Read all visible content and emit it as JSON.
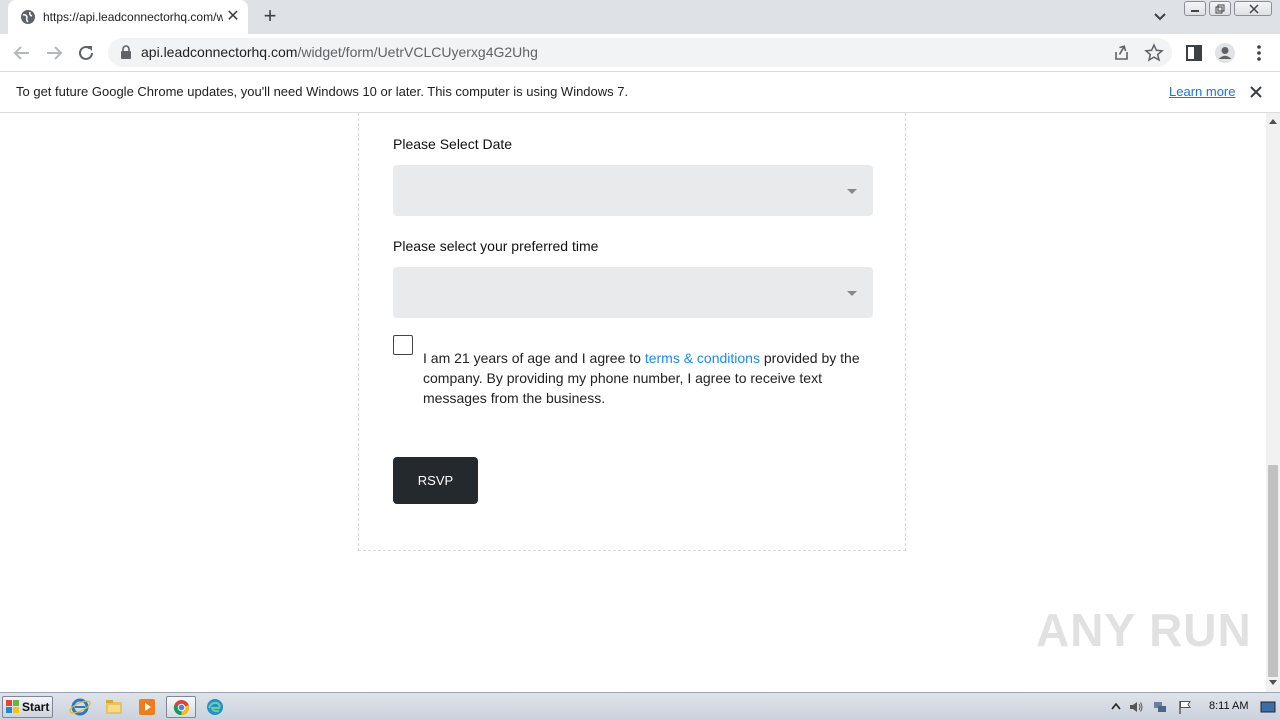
{
  "browser": {
    "tab_title": "https://api.leadconnectorhq.com/wi",
    "address_host": "api.leadconnectorhq.com",
    "address_path": "/widget/form/UetrVCLCUyerxg4G2Uhg"
  },
  "infobar": {
    "message": "To get future Google Chrome updates, you'll need Windows 10 or later. This computer is using Windows 7.",
    "link_label": "Learn more"
  },
  "form": {
    "date_label": "Please Select Date",
    "date_value": "",
    "time_label": "Please select your preferred time",
    "time_value": "",
    "consent_prefix": "I am 21 years of age and I agree to ",
    "consent_link": "terms & conditions",
    "consent_suffix": " provided by the company. By providing my phone number, I agree to receive text messages from the business.",
    "consent_checked": false,
    "submit_label": "RSVP"
  },
  "watermark": "ANY RUN",
  "taskbar": {
    "start_label": "Start",
    "clock": "8:11 AM"
  },
  "colors": {
    "link": "#188bf6",
    "button_bg": "#24292e",
    "select_bg": "#e8eaec"
  }
}
